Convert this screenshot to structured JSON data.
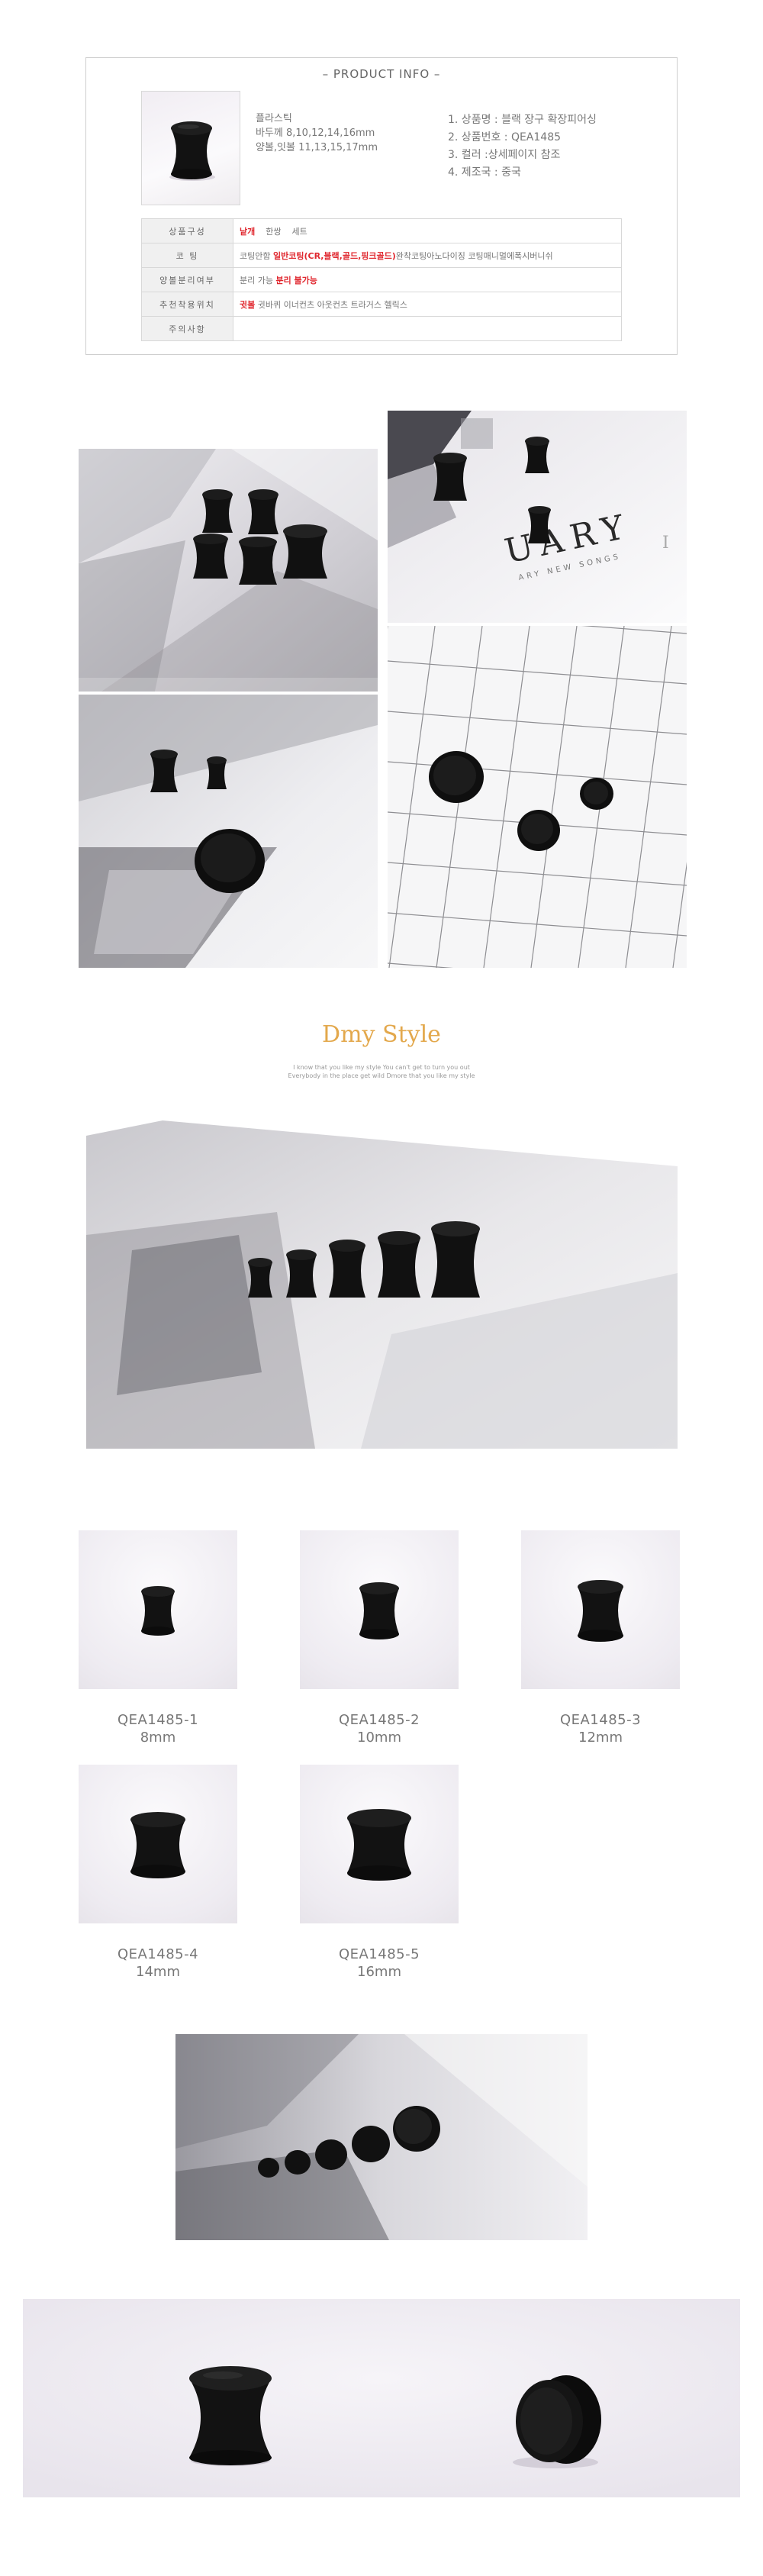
{
  "product_info": {
    "title": "– PRODUCT INFO –",
    "material": "플라스틱",
    "sizes_line": "바두께 8,10,12,14,16mm",
    "ball_line": "양볼,잇볼 11,13,15,17mm",
    "specs": [
      "1. 상품명 : 블랙 장구 확장피어싱",
      "2. 상품번호 : QEA1485",
      "3. 컬러 :상세페이지 참조",
      "4. 제조국 : 중국"
    ],
    "table": {
      "row1_label": "상품구성",
      "row1_opt1": "낱개",
      "row1_opt2": "한쌍",
      "row1_opt3": "세트",
      "row2_label": "코  팅",
      "row2_prefix": "코팅안함",
      "row2_red": "일반코팅(CR,블랙,골드,핑크골드)",
      "row2_suffix": "완착코팅아노다이징 코팅매니멀에폭시버니쉬",
      "row3_label": "양볼분리여부",
      "row3_text": "분리 가능",
      "row3_red": "분리 불가능",
      "row4_label": "추천착용위치",
      "row4_red": "귓볼",
      "row4_text": "귓바퀴 이너컨츠 아웃컨츠 트라거스 헬릭스",
      "row5_label": "주의사항",
      "row5_text": ""
    }
  },
  "brand": {
    "title": "Dmy Style",
    "sub1": "I know that you like my style You can't get to turn you out",
    "sub2": "Everybody in the place get wild Dmore that you like my style"
  },
  "items": [
    {
      "code": "QEA1485-1",
      "size": "8mm"
    },
    {
      "code": "QEA1485-2",
      "size": "10mm"
    },
    {
      "code": "QEA1485-3",
      "size": "12mm"
    },
    {
      "code": "QEA1485-4",
      "size": "14mm"
    },
    {
      "code": "QEA1485-5",
      "size": "16mm"
    }
  ],
  "photo_text": {
    "calendar_word": "UARY",
    "calendar_small": "ARY  NEW  SONGS"
  },
  "colors": {
    "accent_red": "#e0282f",
    "brand_gold": "#e3a84c",
    "product_black": "#111111",
    "background_lavender": "#f3f0f6"
  }
}
